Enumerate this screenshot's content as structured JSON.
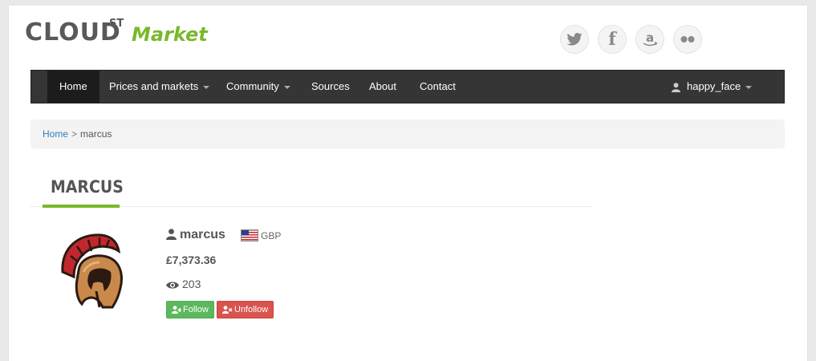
{
  "logo": {
    "brand": "CLOUD",
    "superscript": "ST",
    "tagline": "Market"
  },
  "social": [
    {
      "name": "twitter-icon"
    },
    {
      "name": "facebook-icon",
      "glyph": "f"
    },
    {
      "name": "amazon-icon",
      "glyph": "a"
    },
    {
      "name": "flickr-icon",
      "glyph": "••"
    }
  ],
  "nav": {
    "items": [
      {
        "label": "Home",
        "active": true
      },
      {
        "label": "Prices and markets",
        "dropdown": true
      },
      {
        "label": "Community",
        "dropdown": true
      },
      {
        "label": "Sources"
      },
      {
        "label": "About"
      },
      {
        "label": "Contact"
      }
    ],
    "user": "happy_face"
  },
  "breadcrumb": {
    "home": "Home",
    "separator": ">",
    "current": "marcus"
  },
  "section": {
    "title": "MARCUS"
  },
  "profile": {
    "username": "marcus",
    "currency": "GBP",
    "balance": "£7,373.36",
    "views": "203",
    "follow_label": "Follow",
    "unfollow_label": "Unfollow"
  },
  "colors": {
    "accent": "#7ab82b",
    "navbar": "#353535",
    "link": "#2a7fc0",
    "follow": "#5cb85c",
    "unfollow": "#d9534f"
  }
}
